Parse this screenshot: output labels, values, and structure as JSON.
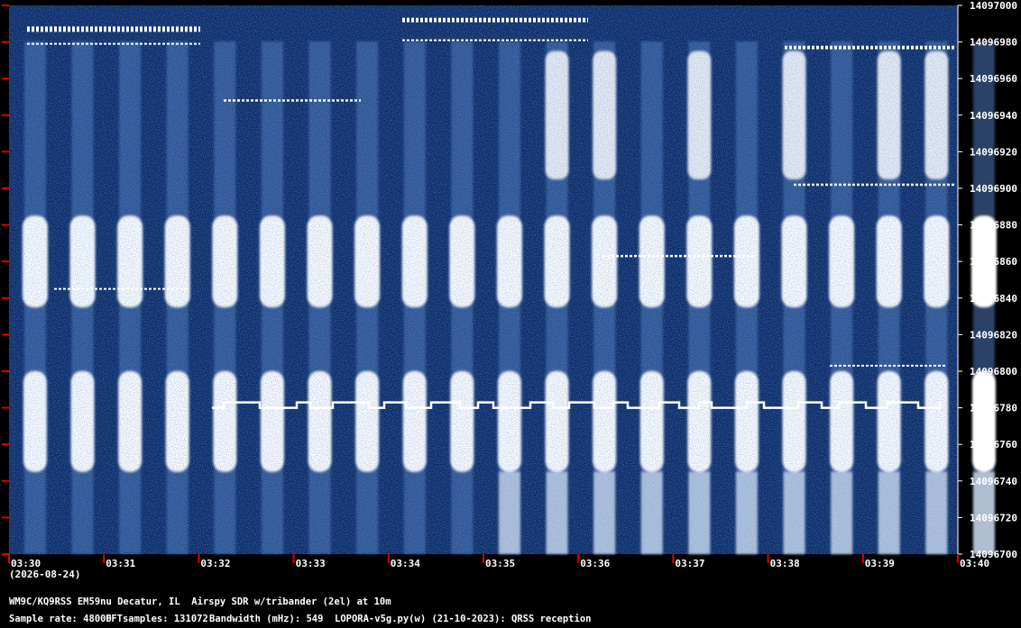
{
  "chart_data": {
    "type": "heatmap",
    "title": "",
    "date_label": "(2026-08-24)",
    "x_ticks": [
      "03:30",
      "03:31",
      "03:32",
      "03:33",
      "03:34",
      "03:35",
      "03:36",
      "03:37",
      "03:38",
      "03:39",
      "03:40"
    ],
    "x_range": [
      "03:30",
      "03:40"
    ],
    "y_range": [
      14096700,
      14097000
    ],
    "y_ticks": [
      14097000,
      14096980,
      14096960,
      14096940,
      14096920,
      14096900,
      14096880,
      14096860,
      14096840,
      14096820,
      14096800,
      14096780,
      14096760,
      14096740,
      14096720,
      14096700
    ],
    "colors": {
      "background": "#0a2a66",
      "signal": "#ffffff",
      "axis_tick": "#e00000"
    },
    "qrss_signal_freq": 14096780
  },
  "footer": {
    "station": "WM9C/KQ9RSS EM59nu Decatur, IL  Airspy SDR w/tribander (2el) at 10m",
    "sample_rate": "Sample rate: 48000",
    "fft_samples": "FFTsamples: 131072",
    "bandwidth": "Bandwidth (mHz): 549",
    "software": "LOPORA-v5g.py(w) (21-10-2023): QRSS reception"
  }
}
